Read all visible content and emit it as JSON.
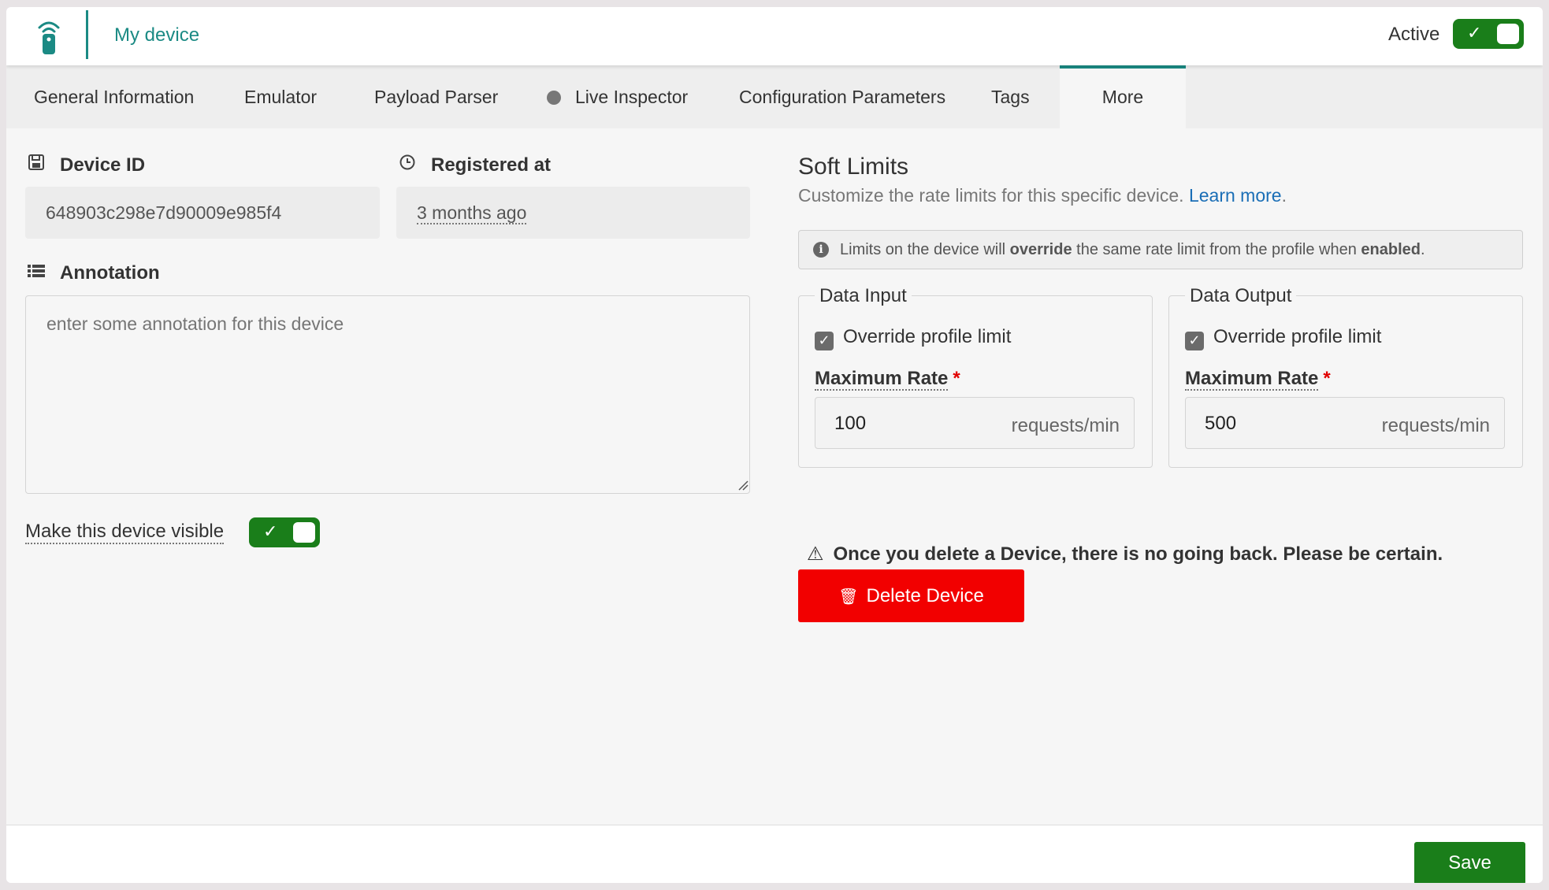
{
  "header": {
    "title": "My device",
    "active_label": "Active",
    "active": true
  },
  "tabs": [
    {
      "label": "General Information"
    },
    {
      "label": "Emulator"
    },
    {
      "label": "Payload Parser"
    },
    {
      "label": "Live Inspector"
    },
    {
      "label": "Configuration Parameters"
    },
    {
      "label": "Tags"
    },
    {
      "label": "More"
    }
  ],
  "active_tab": "More",
  "device": {
    "id_label": "Device ID",
    "id_value": "648903c298e7d90009e985f4",
    "registered_label": "Registered at",
    "registered_value": "3 months ago",
    "annotation_label": "Annotation",
    "annotation_placeholder": "enter some annotation for this device",
    "visible_label": "Make this device visible",
    "visible": true
  },
  "soft_limits": {
    "title": "Soft Limits",
    "description": "Customize the rate limits for this specific device.",
    "learn_more": "Learn more",
    "info_parts": {
      "p1": "Limits on the device will ",
      "b1": "override",
      "p2": " the same rate limit from the profile when ",
      "b2": "enabled",
      "p3": "."
    },
    "data_input": {
      "legend": "Data Input",
      "override_label": "Override profile limit",
      "override_checked": true,
      "max_rate_label": "Maximum Rate",
      "required_mark": "*",
      "value": "100",
      "unit": "requests/min"
    },
    "data_output": {
      "legend": "Data Output",
      "override_label": "Override profile limit",
      "override_checked": true,
      "max_rate_label": "Maximum Rate",
      "required_mark": "*",
      "value": "500",
      "unit": "requests/min"
    }
  },
  "danger": {
    "warning": "Once you delete a Device, there is no going back. Please be certain.",
    "delete_label": "Delete Device"
  },
  "footer": {
    "save_label": "Save"
  },
  "colors": {
    "accent": "#1b8a84",
    "toggle_green": "#1a7e1a",
    "danger_red": "#f20000",
    "link_blue": "#1a6eb6"
  }
}
